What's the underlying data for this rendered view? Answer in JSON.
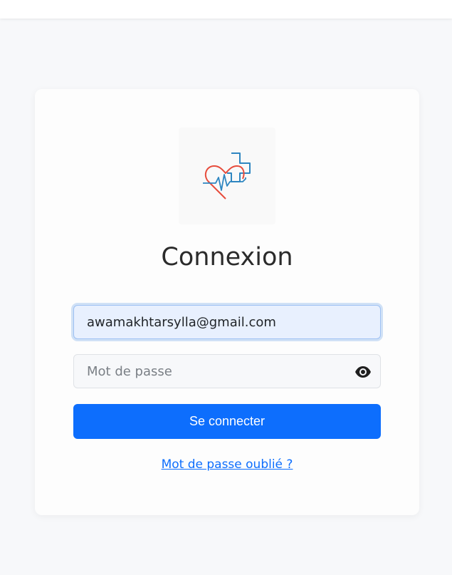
{
  "page": {
    "title": "Connexion"
  },
  "logo": {
    "icon": "heart-medical-cross-icon",
    "colors": {
      "heart": "#e74c3c",
      "cross": "#2e86c1"
    }
  },
  "form": {
    "email_value": "awamakhtarsylla@gmail.com",
    "password_placeholder": "Mot de passe",
    "password_toggle_icon": "eye-icon",
    "submit_label": "Se connecter",
    "forgot_label": "Mot de passe oublié ?"
  },
  "colors": {
    "primary": "#0d6efd",
    "page_background": "#f7f8fa",
    "card_background": "#fdfdfd"
  }
}
